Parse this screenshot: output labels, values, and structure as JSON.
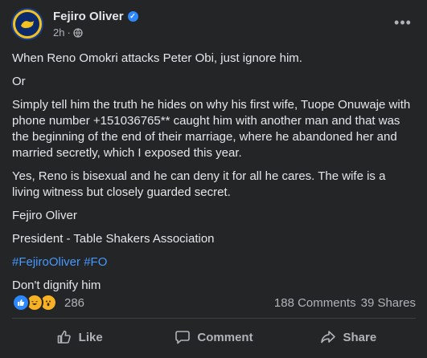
{
  "post": {
    "author": "Fejiro Oliver",
    "time": "2h",
    "separator": "·",
    "more_label": "•••",
    "paragraphs": [
      "When Reno Omokri attacks Peter Obi, just ignore him.",
      "Or",
      "Simply tell him the truth he hides on why his first wife, Tuope Onuwaje with phone number +151036765** caught him with another man and that was the beginning of the end of their marriage, where he abandoned her and married secretly, which I exposed this year.",
      "Yes, Reno is bisexual and he can deny it for all he cares. The wife is a living witness but closely guarded secret.",
      "Fejiro Oliver",
      "President - Table Shakers Association"
    ],
    "hashtags": [
      "#FejiroOliver",
      "#FO"
    ],
    "closing": "Don't dignify him",
    "reactions": {
      "icons": [
        "like-icon",
        "haha-icon",
        "wow-icon"
      ],
      "count": "286"
    },
    "comments": "188 Comments",
    "shares": "39 Shares"
  },
  "actions": {
    "like": "Like",
    "comment": "Comment",
    "share": "Share"
  },
  "colors": {
    "background": "#242526",
    "text": "#e4e6eb",
    "secondary": "#b0b3b8",
    "link": "#4599ff",
    "verified": "#2d88ff"
  }
}
